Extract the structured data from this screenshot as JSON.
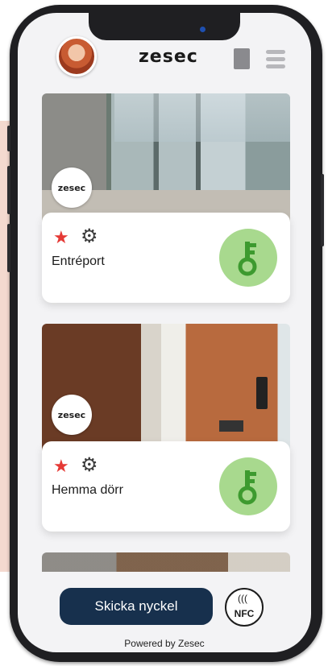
{
  "header": {
    "logo": "zesec",
    "avatar_icon": "user-avatar",
    "grid_icon": "square-icon",
    "menu_icon": "hamburger-menu-icon"
  },
  "locks": [
    {
      "name": "Entréport",
      "badge": "zesec",
      "favorite_icon": "star-icon",
      "settings_icon": "gear-icon",
      "action_icon": "key-icon"
    },
    {
      "name": "Hemma dörr",
      "badge": "zesec",
      "favorite_icon": "star-icon",
      "settings_icon": "gear-icon",
      "action_icon": "key-icon"
    }
  ],
  "footer": {
    "send_key_label": "Skicka nyckel",
    "nfc_label": "NFC",
    "powered_by": "Powered by Zesec"
  },
  "colors": {
    "favorite": "#e53935",
    "key_button": "#a8d98e",
    "key_glyph": "#3d9a2f",
    "primary_button": "#17304d"
  }
}
